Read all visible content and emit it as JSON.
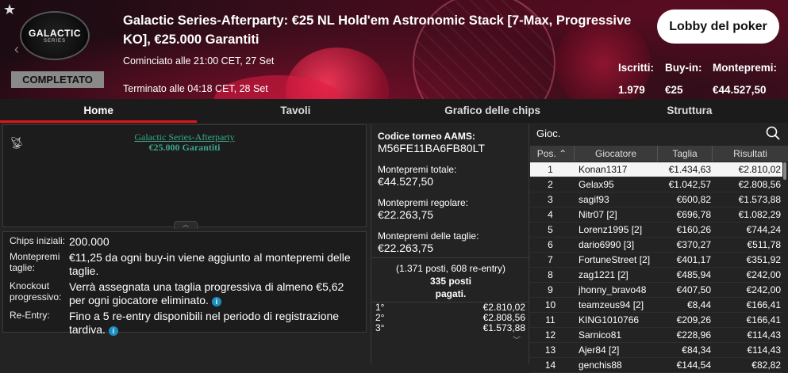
{
  "header": {
    "title": "Galactic Series-Afterparty: €25 NL Hold'em Astronomic Stack [7-Max, Progressive KO], €25.000 Garantiti",
    "started": "Cominciato alle 21:00 CET, 27 Set",
    "ended": "Terminato alle 04:18 CET, 28 Set",
    "status_badge": "COMPLETATO",
    "logo_text": "GALACTIC",
    "logo_sub": "SERIES",
    "lobby_button": "Lobby del poker",
    "stats": [
      {
        "label": "Iscritti:",
        "value": "1.979"
      },
      {
        "label": "Buy-in:",
        "value": "€25"
      },
      {
        "label": "Montepremi:",
        "value": "€44.527,50"
      }
    ]
  },
  "tabs": [
    {
      "label": "Home",
      "active": true
    },
    {
      "label": "Tavoli",
      "active": false
    },
    {
      "label": "Grafico delle chips",
      "active": false
    },
    {
      "label": "Struttura",
      "active": false
    }
  ],
  "tournament_banner": {
    "line1": "Galactic Series-Afterparty",
    "line2": "€25.000 Garantiti"
  },
  "info": [
    {
      "label": "Chips iniziali:",
      "value": "200.000",
      "icon": false
    },
    {
      "label": "Montepremi taglie:",
      "value": "€11,25 da ogni buy-in viene aggiunto al montepremi delle taglie.",
      "icon": false
    },
    {
      "label": "Knockout progressivo:",
      "value": "Verrà assegnata una taglia progressiva di almeno €5,62 per ogni giocatore eliminato.",
      "icon": true
    },
    {
      "label": "Re-Entry:",
      "value": "Fino a 5 re-entry disponibili nel periodo di registrazione tardiva.",
      "icon": true
    }
  ],
  "aams": {
    "label": "Codice torneo AAMS:",
    "value": "M56FE11BA6FB80LT"
  },
  "prizes": [
    {
      "label": "Montepremi totale:",
      "value": "€44.527,50"
    },
    {
      "label": "Montepremi regolare:",
      "value": "€22.263,75"
    },
    {
      "label": "Montepremi delle taglie:",
      "value": "€22.263,75"
    }
  ],
  "places": {
    "line1": "(1.371 posti, 608 re-entry)",
    "line2": "335 posti",
    "line3": "pagati."
  },
  "podium": [
    {
      "pos": "1°",
      "amount": "€2.810,02"
    },
    {
      "pos": "2°",
      "amount": "€2.808,56"
    },
    {
      "pos": "3°",
      "amount": "€1.573,88"
    }
  ],
  "players_panel": {
    "title": "Gioc.",
    "columns": [
      "Pos.",
      "Giocatore",
      "Taglia",
      "Risultati"
    ],
    "rows": [
      [
        "1",
        "Konan1317",
        "€1.434,63",
        "€2.810,02"
      ],
      [
        "2",
        "Gelax95",
        "€1.042,57",
        "€2.808,56"
      ],
      [
        "3",
        "sagif93",
        "€600,82",
        "€1.573,88"
      ],
      [
        "4",
        "Nitr07 [2]",
        "€696,78",
        "€1.082,29"
      ],
      [
        "5",
        "Lorenz1995 [2]",
        "€160,26",
        "€744,24"
      ],
      [
        "6",
        "dario6990 [3]",
        "€370,27",
        "€511,78"
      ],
      [
        "7",
        "FortuneStreet [2]",
        "€401,17",
        "€351,92"
      ],
      [
        "8",
        "zag1221 [2]",
        "€485,94",
        "€242,00"
      ],
      [
        "9",
        "jhonny_bravo48",
        "€407,50",
        "€242,00"
      ],
      [
        "10",
        "teamzeus94 [2]",
        "€8,44",
        "€166,41"
      ],
      [
        "11",
        "KING1010766",
        "€209,26",
        "€166,41"
      ],
      [
        "12",
        "Sarnico81",
        "€228,96",
        "€114,43"
      ],
      [
        "13",
        "Ajer84 [2]",
        "€84,34",
        "€114,43"
      ],
      [
        "14",
        "genchis88",
        "€144,54",
        "€82,82"
      ]
    ]
  }
}
